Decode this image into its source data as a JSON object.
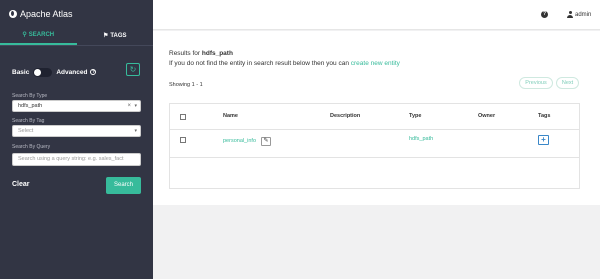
{
  "app": {
    "title": "Apache Atlas"
  },
  "sidebar": {
    "tabs": [
      {
        "label": "SEARCH",
        "icon": "search-icon",
        "active": true
      },
      {
        "label": "TAGS",
        "icon": "tag-icon",
        "active": false
      }
    ],
    "mode": {
      "basic_label": "Basic",
      "advanced_label": "Advanced",
      "selected": "Basic"
    },
    "search_by_type": {
      "label": "Search By Type",
      "value": "hdfs_path"
    },
    "search_by_tag": {
      "label": "Search By Tag",
      "placeholder": "Select"
    },
    "search_by_query": {
      "label": "Search By Query",
      "placeholder": "Search using a query string: e.g. sales_fact"
    },
    "clear_label": "Clear",
    "search_label": "Search"
  },
  "topbar": {
    "help": "?",
    "user": "admin"
  },
  "main": {
    "results_prefix": "Results for ",
    "results_term": "hdfs_path",
    "notfound_text": "If you do not find the entity in search result below then you can ",
    "create_link": "create new entity",
    "showing": "Showing 1 - 1",
    "previous": "Previous",
    "next": "Next",
    "columns": [
      "Name",
      "Description",
      "Type",
      "Owner",
      "Tags"
    ],
    "rows": [
      {
        "name": "personal_info",
        "description": "",
        "type": "hdfs_path",
        "owner": "",
        "tags_action": "+"
      }
    ]
  },
  "colors": {
    "accent": "#37bb9b",
    "sidebar_bg": "#323544",
    "tag_button": "#3a87c8"
  }
}
